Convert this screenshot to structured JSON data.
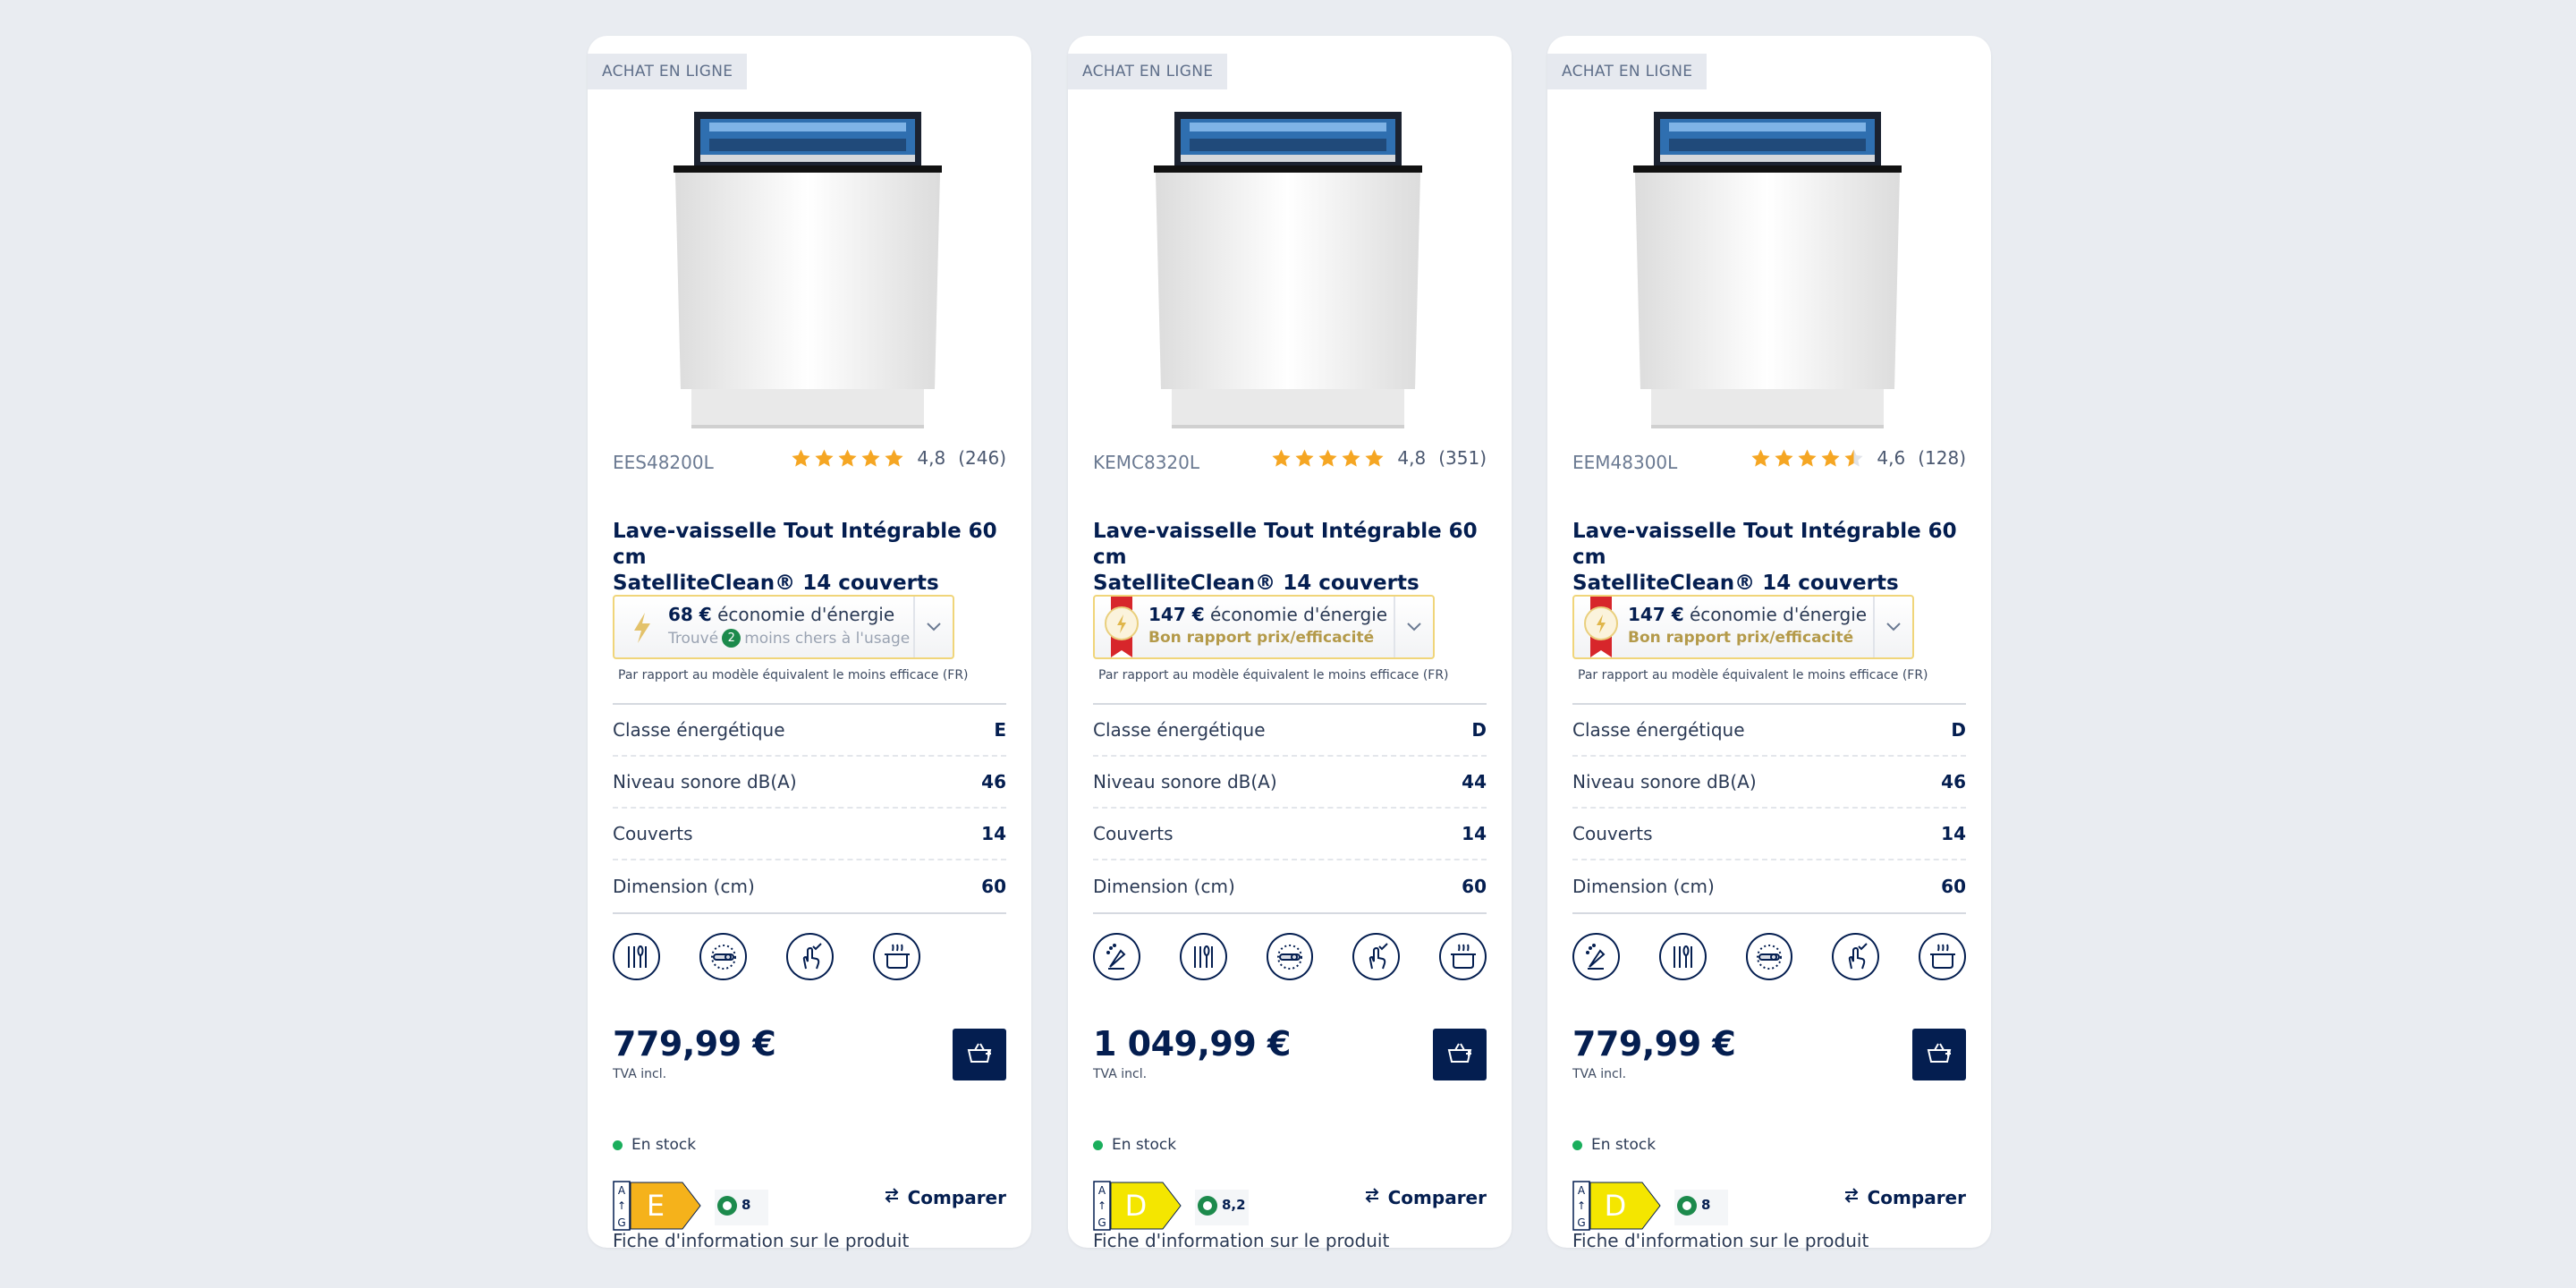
{
  "products": [
    {
      "badge": "ACHAT EN LIGNE",
      "sku": "EES48200L",
      "rating": "4,8",
      "reviews": "(246)",
      "stars": [
        1,
        1,
        1,
        1,
        1
      ],
      "title_line1": "Lave-vaisselle Tout Intégrable 60 cm",
      "title_line2": "SatelliteClean® 14 couverts",
      "energy_amount": "68 €",
      "energy_text": " économie d'énergie",
      "energy_sub_pre": "Trouvé",
      "energy_sub_num": "2",
      "energy_sub_post": "moins chers à l'usage",
      "energy_ribbon": false,
      "energy_note": "Par rapport au modèle équivalent le moins efficace (FR)",
      "specs": [
        {
          "label": "Classe énergétique",
          "value": "E"
        },
        {
          "label": "Niveau sonore dB(A)",
          "value": "46"
        },
        {
          "label": "Couverts",
          "value": "14"
        },
        {
          "label": "Dimension (cm)",
          "value": "60"
        }
      ],
      "features": [
        "cutlery-icon",
        "satellite-spray-icon",
        "touch-icon",
        "pot-icon"
      ],
      "price": "779,99 €",
      "vat": "TVA incl.",
      "stock": "En stock",
      "energy_class": "E",
      "energy_class_color": "#f5b21b",
      "water_value": "8",
      "compare": "Comparer",
      "info_link": "Fiche d'information sur le produit"
    },
    {
      "badge": "ACHAT EN LIGNE",
      "sku": "KEMC8320L",
      "rating": "4,8",
      "reviews": "(351)",
      "stars": [
        1,
        1,
        1,
        1,
        1
      ],
      "title_line1": "Lave-vaisselle Tout Intégrable 60 cm",
      "title_line2": "SatelliteClean® 14 couverts",
      "energy_amount": "147 €",
      "energy_text": " économie d'énergie",
      "energy_sub_pre": "Bon rapport prix/efficacité",
      "energy_sub_num": "",
      "energy_sub_post": "",
      "energy_ribbon": true,
      "energy_note": "Par rapport au modèle équivalent le moins efficace (FR)",
      "specs": [
        {
          "label": "Classe énergétique",
          "value": "D"
        },
        {
          "label": "Niveau sonore dB(A)",
          "value": "44"
        },
        {
          "label": "Couverts",
          "value": "14"
        },
        {
          "label": "Dimension (cm)",
          "value": "60"
        }
      ],
      "features": [
        "spray-arm-icon",
        "cutlery-icon",
        "satellite-spray-icon",
        "touch-icon",
        "pot-icon"
      ],
      "price": "1 049,99 €",
      "vat": "TVA incl.",
      "stock": "En stock",
      "energy_class": "D",
      "energy_class_color": "#f4e600",
      "water_value": "8,2",
      "compare": "Comparer",
      "info_link": "Fiche d'information sur le produit"
    },
    {
      "badge": "ACHAT EN LIGNE",
      "sku": "EEM48300L",
      "rating": "4,6",
      "reviews": "(128)",
      "stars": [
        1,
        1,
        1,
        1,
        0.5
      ],
      "title_line1": "Lave-vaisselle Tout Intégrable 60 cm",
      "title_line2": "SatelliteClean® 14 couverts",
      "energy_amount": "147 €",
      "energy_text": " économie d'énergie",
      "energy_sub_pre": "Bon rapport prix/efficacité",
      "energy_sub_num": "",
      "energy_sub_post": "",
      "energy_ribbon": true,
      "energy_note": "Par rapport au modèle équivalent le moins efficace (FR)",
      "specs": [
        {
          "label": "Classe énergétique",
          "value": "D"
        },
        {
          "label": "Niveau sonore dB(A)",
          "value": "46"
        },
        {
          "label": "Couverts",
          "value": "14"
        },
        {
          "label": "Dimension (cm)",
          "value": "60"
        }
      ],
      "features": [
        "spray-arm-icon",
        "cutlery-icon",
        "satellite-spray-icon",
        "touch-icon",
        "pot-icon"
      ],
      "price": "779,99 €",
      "vat": "TVA incl.",
      "stock": "En stock",
      "energy_class": "D",
      "energy_class_color": "#f4e600",
      "water_value": "8",
      "compare": "Comparer",
      "info_link": "Fiche d'information sur le produit"
    }
  ],
  "colors": {
    "navy": "#041e50",
    "star": "#f5a623",
    "stock_green": "#1aae5c",
    "energy_border": "#f0d57a"
  }
}
